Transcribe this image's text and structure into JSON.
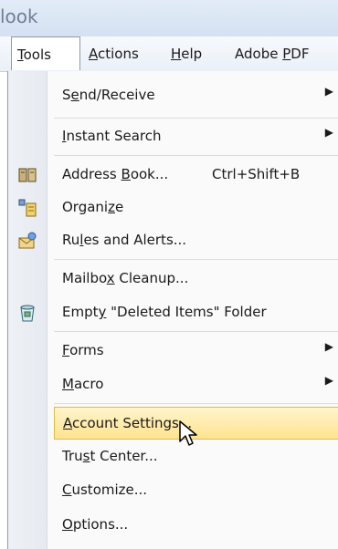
{
  "window": {
    "title_fragment": "look"
  },
  "menubar": {
    "items": [
      {
        "label": "Tools",
        "mn": "T",
        "rest": "ools",
        "active": true
      },
      {
        "label": "Actions",
        "mn": "A",
        "rest": "ctions",
        "active": false
      },
      {
        "label": "Help",
        "mn": "H",
        "rest": "elp",
        "active": false
      },
      {
        "label": "Adobe PDF",
        "pre": "Adobe ",
        "mn": "P",
        "rest": "DF",
        "active": false
      }
    ]
  },
  "tools_menu": {
    "items": [
      {
        "id": "send-receive",
        "pre": "S",
        "mn": "e",
        "post": "nd/Receive",
        "label": "Send/Receive",
        "submenu": true,
        "icon": ""
      },
      {
        "id": "instant-search",
        "pre": "",
        "mn": "I",
        "post": "nstant Search",
        "label": "Instant Search",
        "submenu": true,
        "icon": ""
      },
      {
        "id": "address-book",
        "pre": "Address ",
        "mn": "B",
        "post": "ook...",
        "label": "Address Book...",
        "shortcut": "Ctrl+Shift+B",
        "icon": "address-book-icon"
      },
      {
        "id": "organize",
        "pre": "Organi",
        "mn": "z",
        "post": "e",
        "label": "Organize",
        "icon": "organize-icon"
      },
      {
        "id": "rules-alerts",
        "pre": "Ru",
        "mn": "l",
        "post": "es and Alerts...",
        "label": "Rules and Alerts...",
        "icon": "rules-alerts-icon"
      },
      {
        "id": "mailbox-cleanup",
        "pre": "Mailbo",
        "mn": "x",
        "post": " Cleanup...",
        "label": "Mailbox Cleanup...",
        "icon": ""
      },
      {
        "id": "empty-deleted",
        "pre": "Empt",
        "mn": "y",
        "post": " \"Deleted Items\" Folder",
        "label": "Empty \"Deleted Items\" Folder",
        "icon": "deleted-items-icon"
      },
      {
        "id": "forms",
        "pre": "",
        "mn": "F",
        "post": "orms",
        "label": "Forms",
        "submenu": true,
        "icon": ""
      },
      {
        "id": "macro",
        "pre": "",
        "mn": "M",
        "post": "acro",
        "label": "Macro",
        "submenu": true,
        "icon": ""
      },
      {
        "id": "account-settings",
        "pre": "",
        "mn": "A",
        "post": "ccount Settings...",
        "label": "Account Settings...",
        "highlighted": true,
        "icon": ""
      },
      {
        "id": "trust-center",
        "pre": "Tru",
        "mn": "s",
        "post": "t Center...",
        "label": "Trust Center...",
        "icon": ""
      },
      {
        "id": "customize",
        "pre": "",
        "mn": "C",
        "post": "ustomize...",
        "label": "Customize...",
        "icon": ""
      },
      {
        "id": "options",
        "pre": "",
        "mn": "O",
        "post": "ptions...",
        "label": "Options...",
        "icon": ""
      }
    ]
  },
  "colors": {
    "highlight_top": "#fff5cc",
    "highlight_bottom": "#ffe38f",
    "highlight_border": "#e3b945"
  }
}
